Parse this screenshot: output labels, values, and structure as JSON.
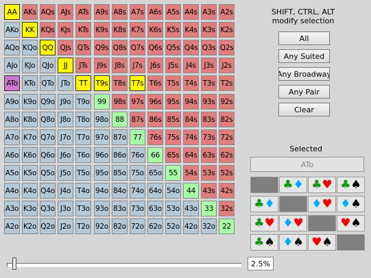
{
  "grid": {
    "rows": [
      [
        "AA",
        "AKs",
        "AQs",
        "AJs",
        "ATs",
        "A9s",
        "A8s",
        "A7s",
        "A6s",
        "A5s",
        "A4s",
        "A3s",
        "A2s"
      ],
      [
        "AKo",
        "KK",
        "KQs",
        "KJs",
        "KTs",
        "K9s",
        "K8s",
        "K7s",
        "K6s",
        "K5s",
        "K4s",
        "K3s",
        "K2s"
      ],
      [
        "AQo",
        "KQo",
        "QQ",
        "QJs",
        "QTs",
        "Q9s",
        "Q8s",
        "Q7s",
        "Q6s",
        "Q5s",
        "Q4s",
        "Q3s",
        "Q2s"
      ],
      [
        "AJo",
        "KJo",
        "QJo",
        "JJ",
        "JTs",
        "J9s",
        "J8s",
        "J7s",
        "J6s",
        "J5s",
        "J4s",
        "J3s",
        "J2s"
      ],
      [
        "ATo",
        "KTo",
        "QTo",
        "JTo",
        "TT",
        "T9s",
        "T8s",
        "T7s",
        "T6s",
        "T5s",
        "T4s",
        "T3s",
        "T2s"
      ],
      [
        "A9o",
        "K9o",
        "Q9o",
        "J9o",
        "T9o",
        "99",
        "98s",
        "97s",
        "96s",
        "95s",
        "94s",
        "93s",
        "92s"
      ],
      [
        "A8o",
        "K8o",
        "Q8o",
        "J8o",
        "T8o",
        "98o",
        "88",
        "87s",
        "86s",
        "85s",
        "84s",
        "83s",
        "82s"
      ],
      [
        "A7o",
        "K7o",
        "Q7o",
        "J7o",
        "T7o",
        "97o",
        "87o",
        "77",
        "76s",
        "75s",
        "74s",
        "73s",
        "72s"
      ],
      [
        "A6o",
        "K6o",
        "Q6o",
        "J6o",
        "T6o",
        "96o",
        "86o",
        "76o",
        "66",
        "65s",
        "64s",
        "63s",
        "62s"
      ],
      [
        "A5o",
        "K5o",
        "Q5o",
        "J5o",
        "T5o",
        "95o",
        "85o",
        "75o",
        "65o",
        "55",
        "54s",
        "53s",
        "52s"
      ],
      [
        "A4o",
        "K4o",
        "Q4o",
        "J4o",
        "T4o",
        "94o",
        "84o",
        "74o",
        "64o",
        "54o",
        "44",
        "43s",
        "42s"
      ],
      [
        "A3o",
        "K3o",
        "Q3o",
        "J3o",
        "T3o",
        "93o",
        "83o",
        "73o",
        "63o",
        "53o",
        "43o",
        "33",
        "32s"
      ],
      [
        "A2o",
        "K2o",
        "Q2o",
        "J2o",
        "T2o",
        "92o",
        "82o",
        "72o",
        "62o",
        "52o",
        "42o",
        "32o",
        "22"
      ]
    ],
    "selected": [
      "AA",
      "KK",
      "QQ",
      "JJ",
      "TT",
      "T9s",
      "T7s"
    ],
    "current": "ATo"
  },
  "hint": {
    "line1": "SHIFT, CTRL, ALT",
    "line2": "modify selection"
  },
  "buttons": {
    "all": "All",
    "any_suited": "Any Suited",
    "any_broadway": "Any Broadway",
    "any_pair": "Any Pair",
    "clear": "Clear"
  },
  "selected_label": "Selected",
  "selected_value": "ATo",
  "suit_order": [
    "club",
    "diamond",
    "heart",
    "spade"
  ],
  "slider": {
    "percent_text": "2.5%",
    "fraction": 0.025
  },
  "colors": {
    "pair": "#a9fca7",
    "suited": "#e07d7d",
    "offsuit": "#b5c8d6",
    "selected": "#fff700",
    "current": "#cc77cc",
    "diagonal": "#7f7f7f"
  }
}
